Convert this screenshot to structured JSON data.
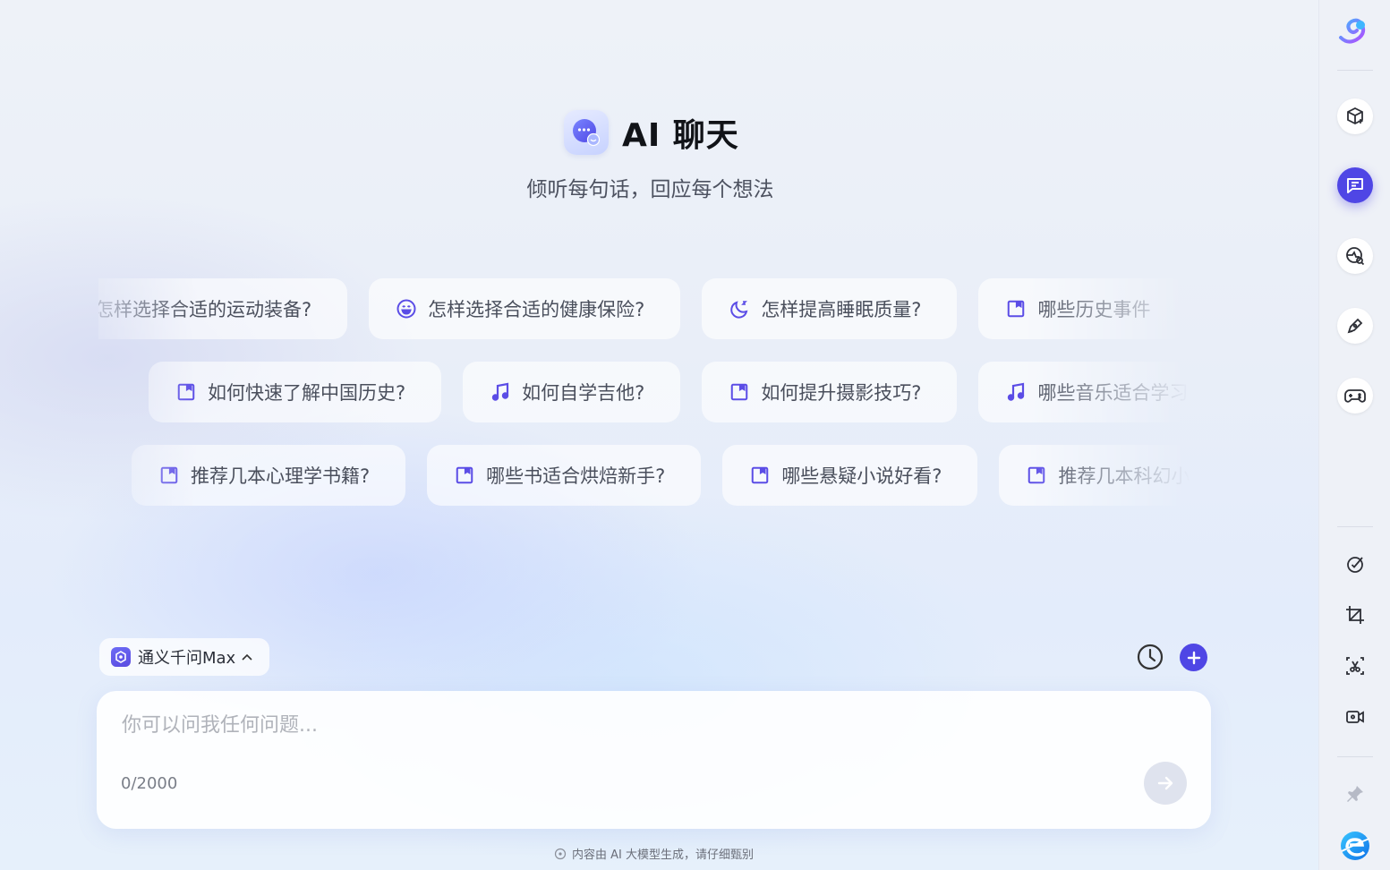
{
  "header": {
    "title": "AI 聊天",
    "subtitle": "倾听每句话，回应每个想法"
  },
  "suggestions": {
    "row1": [
      {
        "icon": "dumbbell-icon",
        "label": "怎样选择合适的运动装备?"
      },
      {
        "icon": "smile-icon",
        "label": "怎样选择合适的健康保险?"
      },
      {
        "icon": "moon-icon",
        "label": "怎样提高睡眠质量?"
      },
      {
        "icon": "book-icon",
        "label": "哪些历史事件"
      }
    ],
    "row2": [
      {
        "icon": "book-icon",
        "label": "如何快速了解中国历史?"
      },
      {
        "icon": "music-icon",
        "label": "如何自学吉他?"
      },
      {
        "icon": "book-icon",
        "label": "如何提升摄影技巧?"
      },
      {
        "icon": "music-icon",
        "label": "哪些音乐适合学习"
      }
    ],
    "row3": [
      {
        "icon": "book-icon",
        "label": "推荐几本心理学书籍?"
      },
      {
        "icon": "book-icon",
        "label": "哪些书适合烘焙新手?"
      },
      {
        "icon": "book-icon",
        "label": "哪些悬疑小说好看?"
      },
      {
        "icon": "book-icon",
        "label": "推荐几本科幻小"
      }
    ]
  },
  "composer": {
    "model_label": "通义千问Max",
    "placeholder": "你可以问我任何问题...",
    "value": "",
    "counter": "0/2000"
  },
  "footer": {
    "disclaimer": "内容由 AI 大模型生成，请仔细甄别"
  },
  "colors": {
    "accent": "#4f46e5",
    "text_primary": "#111318",
    "text_secondary": "#4a4f5c"
  },
  "sidebar": {
    "items": [
      {
        "name": "app-logo-icon"
      },
      {
        "name": "box-plus-icon"
      },
      {
        "name": "chat-icon",
        "active": true
      },
      {
        "name": "globe-search-icon"
      },
      {
        "name": "pen-icon"
      },
      {
        "name": "gamepad-icon"
      },
      {
        "name": "check-circle-icon"
      },
      {
        "name": "crop-icon"
      },
      {
        "name": "scissors-icon"
      },
      {
        "name": "video-icon"
      },
      {
        "name": "pin-icon"
      },
      {
        "name": "browser-logo-icon"
      }
    ]
  }
}
